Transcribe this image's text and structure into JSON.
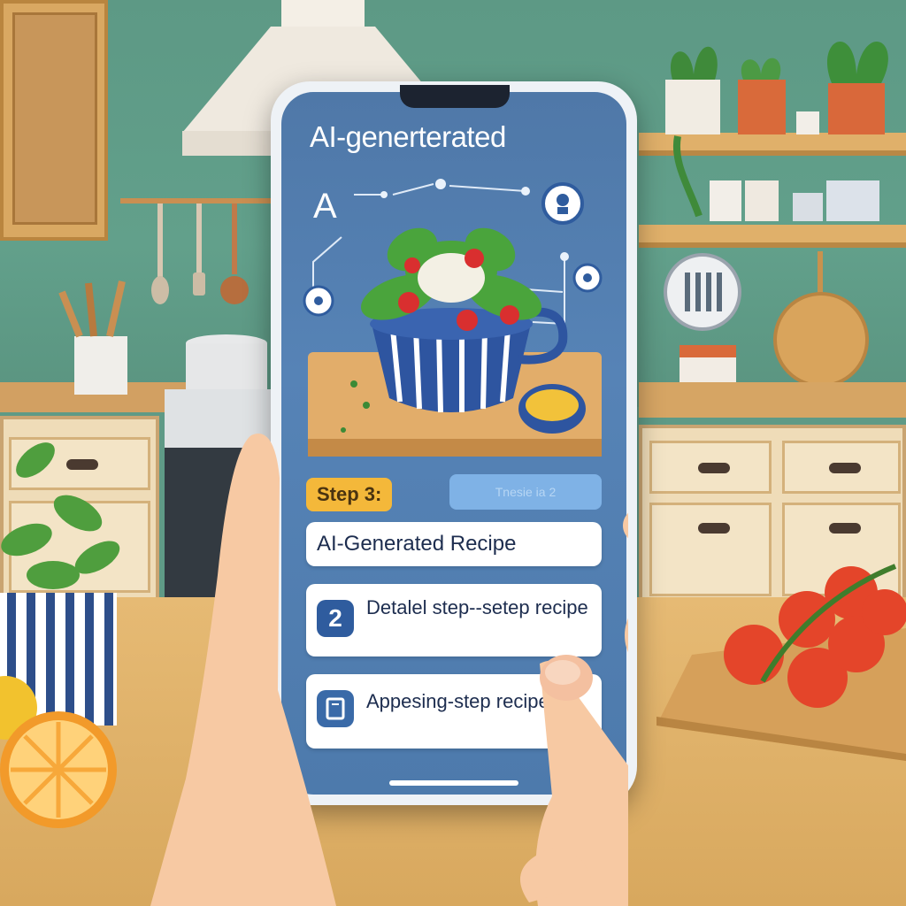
{
  "app": {
    "title": "AI-generterated"
  },
  "hero": {
    "dish": "salad bowl",
    "icons": [
      "ai-letter-icon",
      "robot-face-icon",
      "network-node-icon"
    ]
  },
  "stepper": {
    "current_label": "Step 3:",
    "next_label": "Tnesie ia 2"
  },
  "cards": {
    "title": "AI-Generated Recipe",
    "step_number": "2",
    "step_text": "Detalel step--setep recipe",
    "second_text": "Appesing-step recipe"
  },
  "colors": {
    "screen": "#5683b6",
    "accent": "#f4b83a",
    "badge": "#2f5c9e",
    "wall": "#5f9a86"
  }
}
